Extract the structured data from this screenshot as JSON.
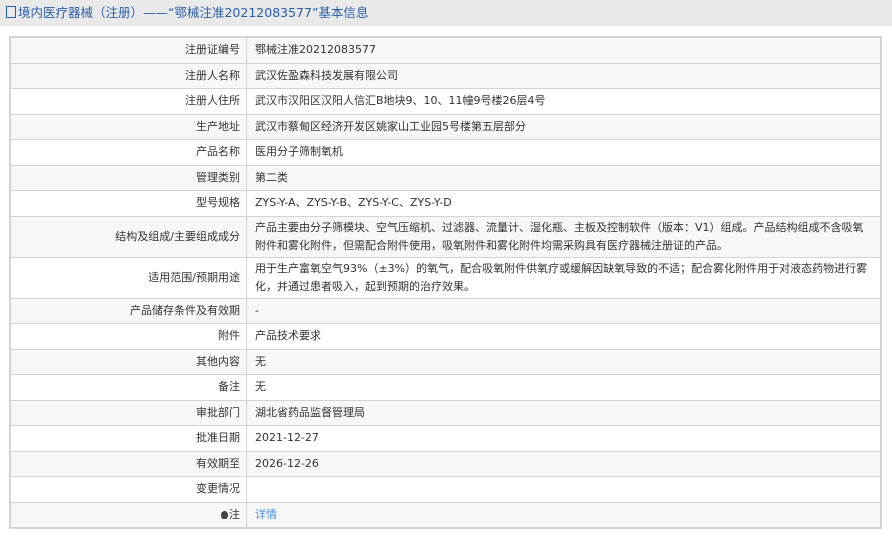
{
  "header": {
    "title": "境内医疗器械（注册）——“鄂械注准20212083577”基本信息"
  },
  "rows": [
    {
      "label": "注册证编号",
      "value": "鄂械注准20212083577"
    },
    {
      "label": "注册人名称",
      "value": "武汉佐盈森科技发展有限公司"
    },
    {
      "label": "注册人住所",
      "value": "武汉市汉阳区汉阳人信汇B地块9、10、11幢9号楼26层4号"
    },
    {
      "label": "生产地址",
      "value": "武汉市蔡甸区经济开发区姚家山工业园5号楼第五层部分"
    },
    {
      "label": "产品名称",
      "value": "医用分子筛制氧机"
    },
    {
      "label": "管理类别",
      "value": "第二类"
    },
    {
      "label": "型号规格",
      "value": "ZYS-Y-A、ZYS-Y-B、ZYS-Y-C、ZYS-Y-D"
    },
    {
      "label": "结构及组成/主要组成成分",
      "value": "产品主要由分子筛模块、空气压缩机、过滤器、流量计、湿化瓶、主板及控制软件（版本：V1）组成。产品结构组成不含吸氧附件和雾化附件，但需配合附件使用，吸氧附件和雾化附件均需采购具有医疗器械注册证的产品。"
    },
    {
      "label": "适用范围/预期用途",
      "value": "用于生产富氧空气93%（±3%）的氧气，配合吸氧附件供氧疗或缓解因缺氧导致的不适；配合雾化附件用于对液态药物进行雾化，并通过患者吸入，起到预期的治疗效果。"
    },
    {
      "label": "产品储存条件及有效期",
      "value": "-"
    },
    {
      "label": "附件",
      "value": "产品技术要求"
    },
    {
      "label": "其他内容",
      "value": "无"
    },
    {
      "label": "备注",
      "value": "无"
    },
    {
      "label": "审批部门",
      "value": "湖北省药品监督管理局"
    },
    {
      "label": "批准日期",
      "value": "2021-12-27"
    },
    {
      "label": "有效期至",
      "value": "2026-12-26"
    },
    {
      "label": "变更情况",
      "value": ""
    }
  ],
  "note": {
    "label": "注",
    "link": "详情"
  }
}
